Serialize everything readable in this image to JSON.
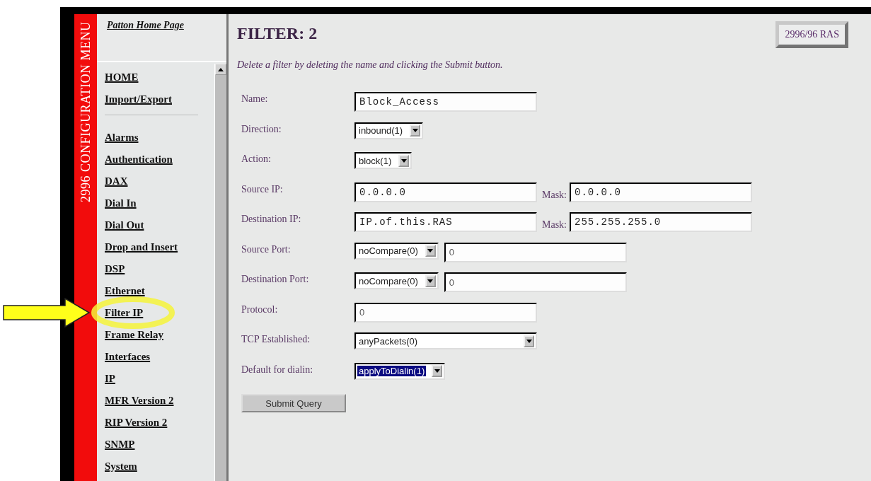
{
  "side_banner": "2996 CONFIGURATION MENU",
  "home_link": "Patton Home Page",
  "nav": {
    "groups": [
      [
        {
          "label": "HOME",
          "highlighted": false
        },
        {
          "label": "Import/Export",
          "highlighted": false
        }
      ],
      [
        {
          "label": "Alarms",
          "highlighted": false
        },
        {
          "label": "Authentication",
          "highlighted": false
        },
        {
          "label": "DAX",
          "highlighted": false
        },
        {
          "label": "Dial In",
          "highlighted": false
        },
        {
          "label": "Dial Out",
          "highlighted": false
        },
        {
          "label": "Drop and Insert",
          "highlighted": false
        },
        {
          "label": "DSP",
          "highlighted": false
        },
        {
          "label": "Ethernet",
          "highlighted": false
        },
        {
          "label": "Filter IP",
          "highlighted": true
        },
        {
          "label": "Frame Relay",
          "highlighted": false
        },
        {
          "label": "Interfaces",
          "highlighted": false
        },
        {
          "label": "IP",
          "highlighted": false
        },
        {
          "label": "MFR Version 2",
          "highlighted": false
        },
        {
          "label": "RIP Version 2",
          "highlighted": false
        },
        {
          "label": "SNMP",
          "highlighted": false
        },
        {
          "label": "System",
          "highlighted": false
        }
      ]
    ]
  },
  "page": {
    "title": "FILTER: 2",
    "badge": "2996/96 RAS",
    "hint": "Delete a filter by deleting the name and clicking the Submit button.",
    "rows": [
      {
        "label": "Name:",
        "kind": "text",
        "value": "Block_Access"
      },
      {
        "label": "Direction:",
        "kind": "select",
        "value": "inbound(1)",
        "focused": false
      },
      {
        "label": "Action:",
        "kind": "select",
        "value": "block(1)",
        "focused": false
      },
      {
        "label": "Source IP:",
        "kind": "ip_mask",
        "value": "0.0.0.0",
        "mask_label": "Mask:",
        "mask": "0.0.0.0"
      },
      {
        "label": "Destination IP:",
        "kind": "ip_mask",
        "value": "IP.of.this.RAS",
        "mask_label": "Mask:",
        "mask": "255.255.255.0"
      },
      {
        "label": "Source Port:",
        "kind": "select_number",
        "value": "noCompare(0)",
        "number": "0"
      },
      {
        "label": "Destination Port:",
        "kind": "select_number",
        "value": "noCompare(0)",
        "number": "0"
      },
      {
        "label": "Protocol:",
        "kind": "number",
        "value": "0"
      },
      {
        "label": "TCP Established:",
        "kind": "wide_select",
        "value": "anyPackets(0)",
        "focused": false
      },
      {
        "label": "Default for dialin:",
        "kind": "select",
        "value": "applyToDialin(1)",
        "focused": true
      }
    ],
    "submit": "Submit Query"
  }
}
